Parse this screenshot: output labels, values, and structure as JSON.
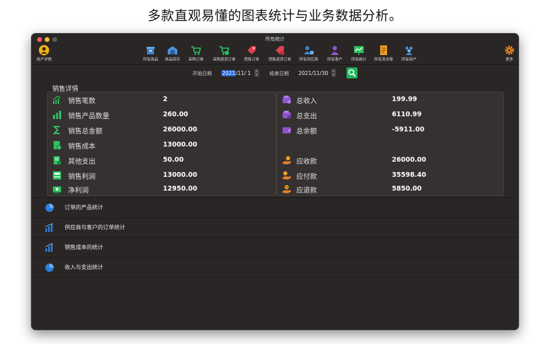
{
  "banner": {
    "headline": "多款直观易懂的图表统计与业务数据分析。"
  },
  "window": {
    "title": "所有统计"
  },
  "toolbar": {
    "user_label": "用户详情",
    "more_label": "更多",
    "items": [
      {
        "label": "所有商品",
        "icon": "archive-box-icon"
      },
      {
        "label": "商品库存",
        "icon": "warehouse-icon"
      },
      {
        "label": "采购订单",
        "icon": "cart-icon"
      },
      {
        "label": "采购退货订单",
        "icon": "cart-return-icon"
      },
      {
        "label": "销售订单",
        "icon": "tag-icon"
      },
      {
        "label": "销售退货订单",
        "icon": "tag-return-icon"
      },
      {
        "label": "所有供应商",
        "icon": "supplier-icon"
      },
      {
        "label": "所有客户",
        "icon": "customer-icon"
      },
      {
        "label": "所有统计",
        "icon": "presentation-chart-icon"
      },
      {
        "label": "所有流水账",
        "icon": "ledger-icon"
      },
      {
        "label": "所有用户",
        "icon": "users-group-icon"
      }
    ]
  },
  "dates": {
    "start_label": "开始日期",
    "start_value_selected": "2021",
    "start_value_rest": "/11/  1",
    "end_label": "结束日期",
    "end_value": "2021/11/30"
  },
  "sales": {
    "title": "销售详情",
    "left": [
      {
        "label": "销售笔数",
        "value": "2"
      },
      {
        "label": "销售产品数量",
        "value": "260.00"
      },
      {
        "label": "销售总金额",
        "value": "26000.00"
      },
      {
        "label": "销售成本",
        "value": "13000.00"
      },
      {
        "label": "其他支出",
        "value": "50.00"
      },
      {
        "label": "销售利润",
        "value": "13000.00"
      },
      {
        "label": "净利润",
        "value": "12950.00"
      }
    ],
    "right": [
      {
        "label": "总收入",
        "value": "199.99"
      },
      {
        "label": "总支出",
        "value": "6110.99"
      },
      {
        "label": "总余额",
        "value": "-5911.00"
      },
      {
        "label": "应收款",
        "value": "26000.00"
      },
      {
        "label": "应付款",
        "value": "35598.40"
      },
      {
        "label": "应退款",
        "value": "5850.00"
      }
    ]
  },
  "stats_list": [
    {
      "label": "订单的产品统计",
      "icon": "pie-chart-icon"
    },
    {
      "label": "供应商与客户的订单统计",
      "icon": "bar-chart-icon"
    },
    {
      "label": "销售成本的统计",
      "icon": "bar-chart-icon"
    },
    {
      "label": "收入与支出统计",
      "icon": "pie-chart-icon"
    }
  ],
  "colors": {
    "window_bg": "#2a2626",
    "accent_blue": "#2a64d6",
    "green": "#1fb45c",
    "purple": "#8e54c9",
    "orange": "#e8822a"
  }
}
